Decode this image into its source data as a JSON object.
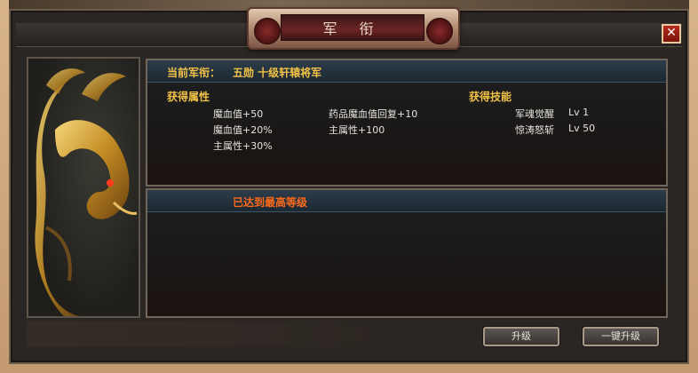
{
  "window": {
    "title": "军 衔",
    "close_label": "✕"
  },
  "rank": {
    "label": "当前军衔：",
    "value": "五勋 十级轩辕将军"
  },
  "attributes": {
    "heading": "获得属性",
    "col1": [
      "魔血值+50",
      "魔血值+20%",
      "主属性+30%"
    ],
    "col2": [
      "药品魔血值回复+10",
      "主属性+100"
    ]
  },
  "skills": {
    "heading": "获得技能",
    "items": [
      {
        "name": "军魂觉醒",
        "level": "Lv 1"
      },
      {
        "name": "惊涛怒斩",
        "level": "Lv 50"
      }
    ]
  },
  "status": {
    "message": "已达到最高等级"
  },
  "buttons": {
    "upgrade": "升级",
    "upgrade_all": "一键升级"
  },
  "colors": {
    "accent_gold": "#f2c247",
    "alert_orange": "#ff6a1a",
    "close_red": "#b82a1c"
  }
}
